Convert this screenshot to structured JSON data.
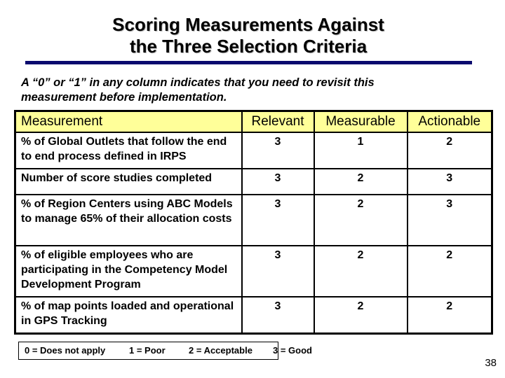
{
  "slide": {
    "title_lines": [
      "Scoring Measurements Against",
      "the Three Selection Criteria"
    ],
    "accent_color": "#0a0a6e",
    "header_fill_color": "#ffff99",
    "note": "A “0” or “1” in any column indicates that you need to revisit this measurement before implementation.",
    "page_number": "38"
  },
  "table": {
    "headers": [
      "Measurement",
      "Relevant",
      "Measurable",
      "Actionable"
    ],
    "rows": [
      {
        "measurement": "% of Global Outlets that follow the end to end process defined in IRPS",
        "relevant": "3",
        "measurable": "1",
        "actionable": "2"
      },
      {
        "measurement": "Number of score studies completed",
        "relevant": "3",
        "measurable": "2",
        "actionable": "3"
      },
      {
        "measurement": "% of Region Centers using ABC Models to manage 65% of their allocation costs",
        "relevant": "3",
        "measurable": "2",
        "actionable": "3"
      },
      {
        "measurement": "% of eligible employees who are participating in the Competency Model Development Program",
        "relevant": "3",
        "measurable": "2",
        "actionable": "2"
      },
      {
        "measurement": "% of map points loaded and operational in GPS Tracking",
        "relevant": "3",
        "measurable": "2",
        "actionable": "2"
      }
    ]
  },
  "legend": {
    "items": [
      "0 = Does not apply",
      "1 = Poor",
      "2 = Acceptable",
      "3 = Good"
    ]
  }
}
